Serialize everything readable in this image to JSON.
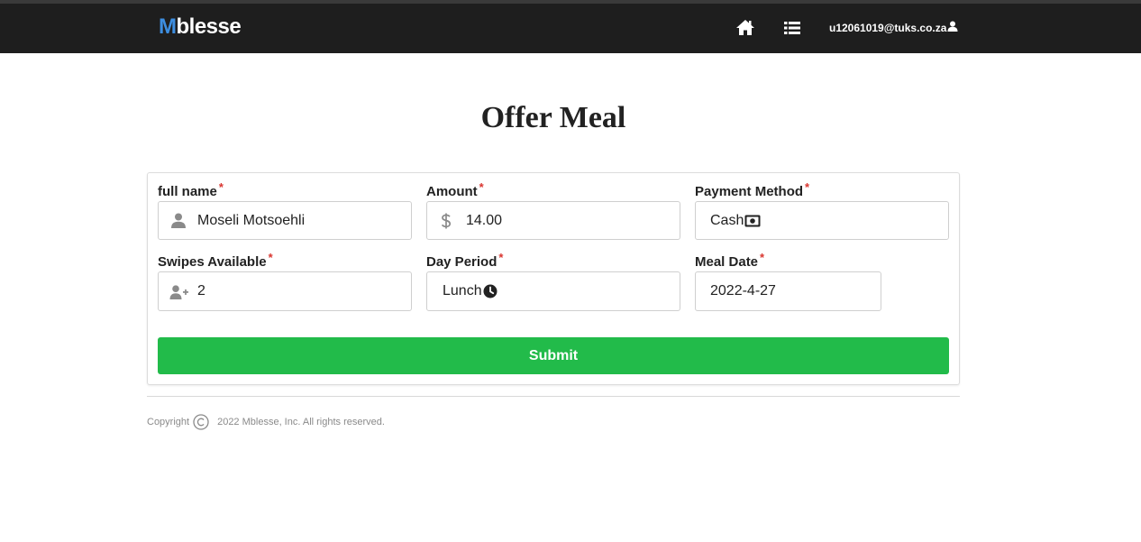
{
  "navbar": {
    "brand_initial": "M",
    "brand_rest": "blesse",
    "home_icon": "home-icon",
    "menu_icon": "list-icon",
    "user_email": "u12061019@tuks.co.za",
    "user_icon": "user-icon"
  },
  "page": {
    "title": "Offer Meal"
  },
  "form": {
    "required_marker": "*",
    "full_name": {
      "label": "full name",
      "value": "Moseli Motsoehli",
      "icon": "user-icon"
    },
    "amount": {
      "label": "Amount",
      "value": "14.00",
      "icon": "dollar-icon"
    },
    "payment_method": {
      "label": "Payment Method",
      "value": "Cash",
      "icon": "money-bill-icon"
    },
    "swipes_available": {
      "label": "Swipes Available",
      "value": "2",
      "icon": "user-plus-icon"
    },
    "day_period": {
      "label": "Day Period",
      "value": "Lunch",
      "icon": "clock-icon"
    },
    "meal_date": {
      "label": "Meal Date",
      "value": "2022-4-27"
    },
    "submit_label": "Submit"
  },
  "footer": {
    "copyright_label": "Copyright",
    "copyright_icon": "copyright-icon",
    "text": "2022 Mblesse, Inc. All rights reserved."
  },
  "colors": {
    "navbar_bg": "#1e1e1e",
    "brand_accent": "#3d8ee0",
    "required": "#d9352f",
    "submit_bg": "#22bb4a"
  }
}
